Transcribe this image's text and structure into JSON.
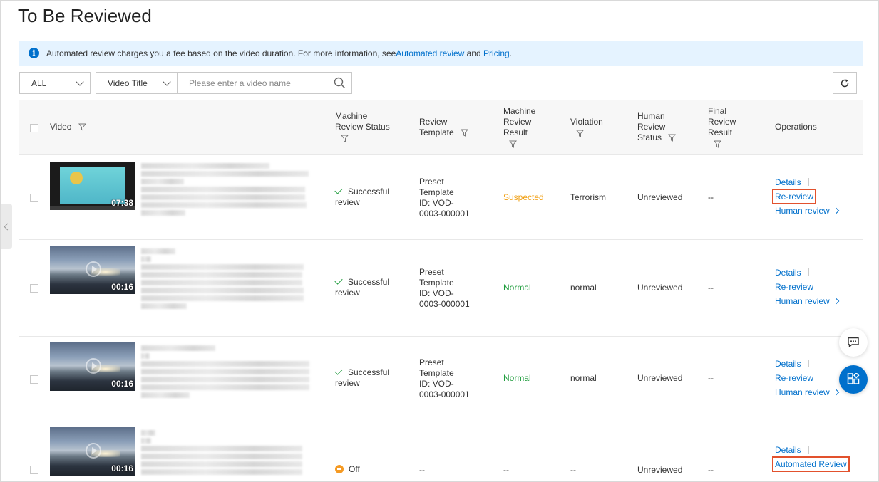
{
  "page": {
    "title": "To Be Reviewed"
  },
  "notice": {
    "text": "Automated review charges you a fee based on the video duration. For more information, see ",
    "link1": "Automated review",
    "and": " and ",
    "link2": "Pricing",
    "end": "."
  },
  "filters": {
    "scope": "ALL",
    "field": "Video Title",
    "search_placeholder": "Please enter a video name"
  },
  "columns": {
    "video": "Video",
    "machine_status_1": "Machine",
    "machine_status_2": "Review Status",
    "template_1": "Review",
    "template_2": "Template",
    "machine_result_1": "Machine",
    "machine_result_2": "Review",
    "machine_result_3": "Result",
    "violation": "Violation",
    "human_1": "Human",
    "human_2": "Review",
    "human_3": "Status",
    "final_1": "Final",
    "final_2": "Review",
    "final_3": "Result",
    "operations": "Operations"
  },
  "rows": [
    {
      "duration": "07:38",
      "status_1": "Successful",
      "status_2": "review",
      "tpl_1": "Preset",
      "tpl_2": "Template",
      "tpl_3": "ID: VOD-",
      "tpl_4": "0003-000001",
      "result": "Suspected",
      "violation": "Terrorism",
      "human": "Unreviewed",
      "final": "--",
      "op_details": "Details",
      "op_rereview": "Re-review",
      "op_human": "Human review"
    },
    {
      "duration": "00:16",
      "status_1": "Successful",
      "status_2": "review",
      "tpl_1": "Preset",
      "tpl_2": "Template",
      "tpl_3": "ID: VOD-",
      "tpl_4": "0003-000001",
      "result": "Normal",
      "violation": "normal",
      "human": "Unreviewed",
      "final": "--",
      "op_details": "Details",
      "op_rereview": "Re-review",
      "op_human": "Human review"
    },
    {
      "duration": "00:16",
      "status_1": "Successful",
      "status_2": "review",
      "tpl_1": "Preset",
      "tpl_2": "Template",
      "tpl_3": "ID: VOD-",
      "tpl_4": "0003-000001",
      "result": "Normal",
      "violation": "normal",
      "human": "Unreviewed",
      "final": "--",
      "op_details": "Details",
      "op_rereview": "Re-review",
      "op_human": "Human review"
    },
    {
      "duration": "00:16",
      "status": "Off",
      "template": "--",
      "result": "--",
      "violation": "--",
      "human": "Unreviewed",
      "final": "--",
      "op_details": "Details",
      "op_auto": "Automated Review"
    }
  ],
  "colors": {
    "accent": "#0070cc",
    "suspected": "#f0a015",
    "normal": "#1e9c3c",
    "highlight": "#e2512d"
  },
  "icons": [
    "info-icon",
    "chevron-down-icon",
    "search-icon",
    "refresh-icon",
    "filter-icon",
    "check-icon",
    "off-icon",
    "chevron-right-icon",
    "chevron-left-icon",
    "chat-icon",
    "apps-icon"
  ]
}
